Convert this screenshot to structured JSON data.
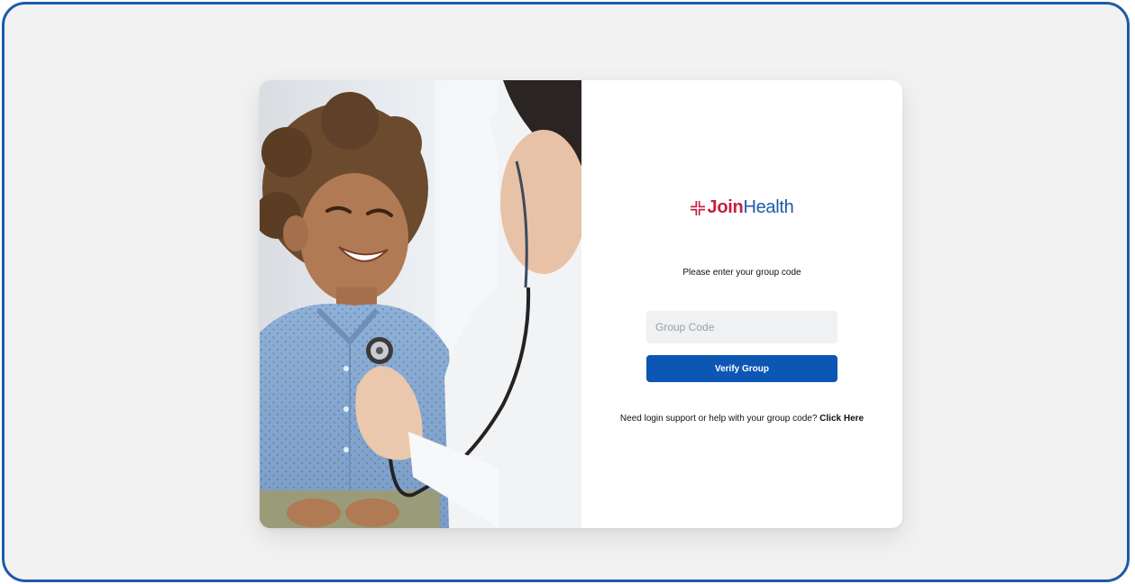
{
  "brand": {
    "logo_icon": "medical-cross-icon",
    "name_part1": "Join",
    "name_part2": "Health",
    "color_primary": "#c51f3d",
    "color_secondary": "#1f5aa6"
  },
  "hero_image": {
    "icon": "doctor-child-stethoscope-photo"
  },
  "form": {
    "prompt": "Please enter your group code",
    "group_code_value": "",
    "group_code_placeholder": "Group Code",
    "submit_label": "Verify Group",
    "button_color": "#0b57b3"
  },
  "help": {
    "text": "Need login support or help with your group code?",
    "link_label": "Click Here"
  }
}
